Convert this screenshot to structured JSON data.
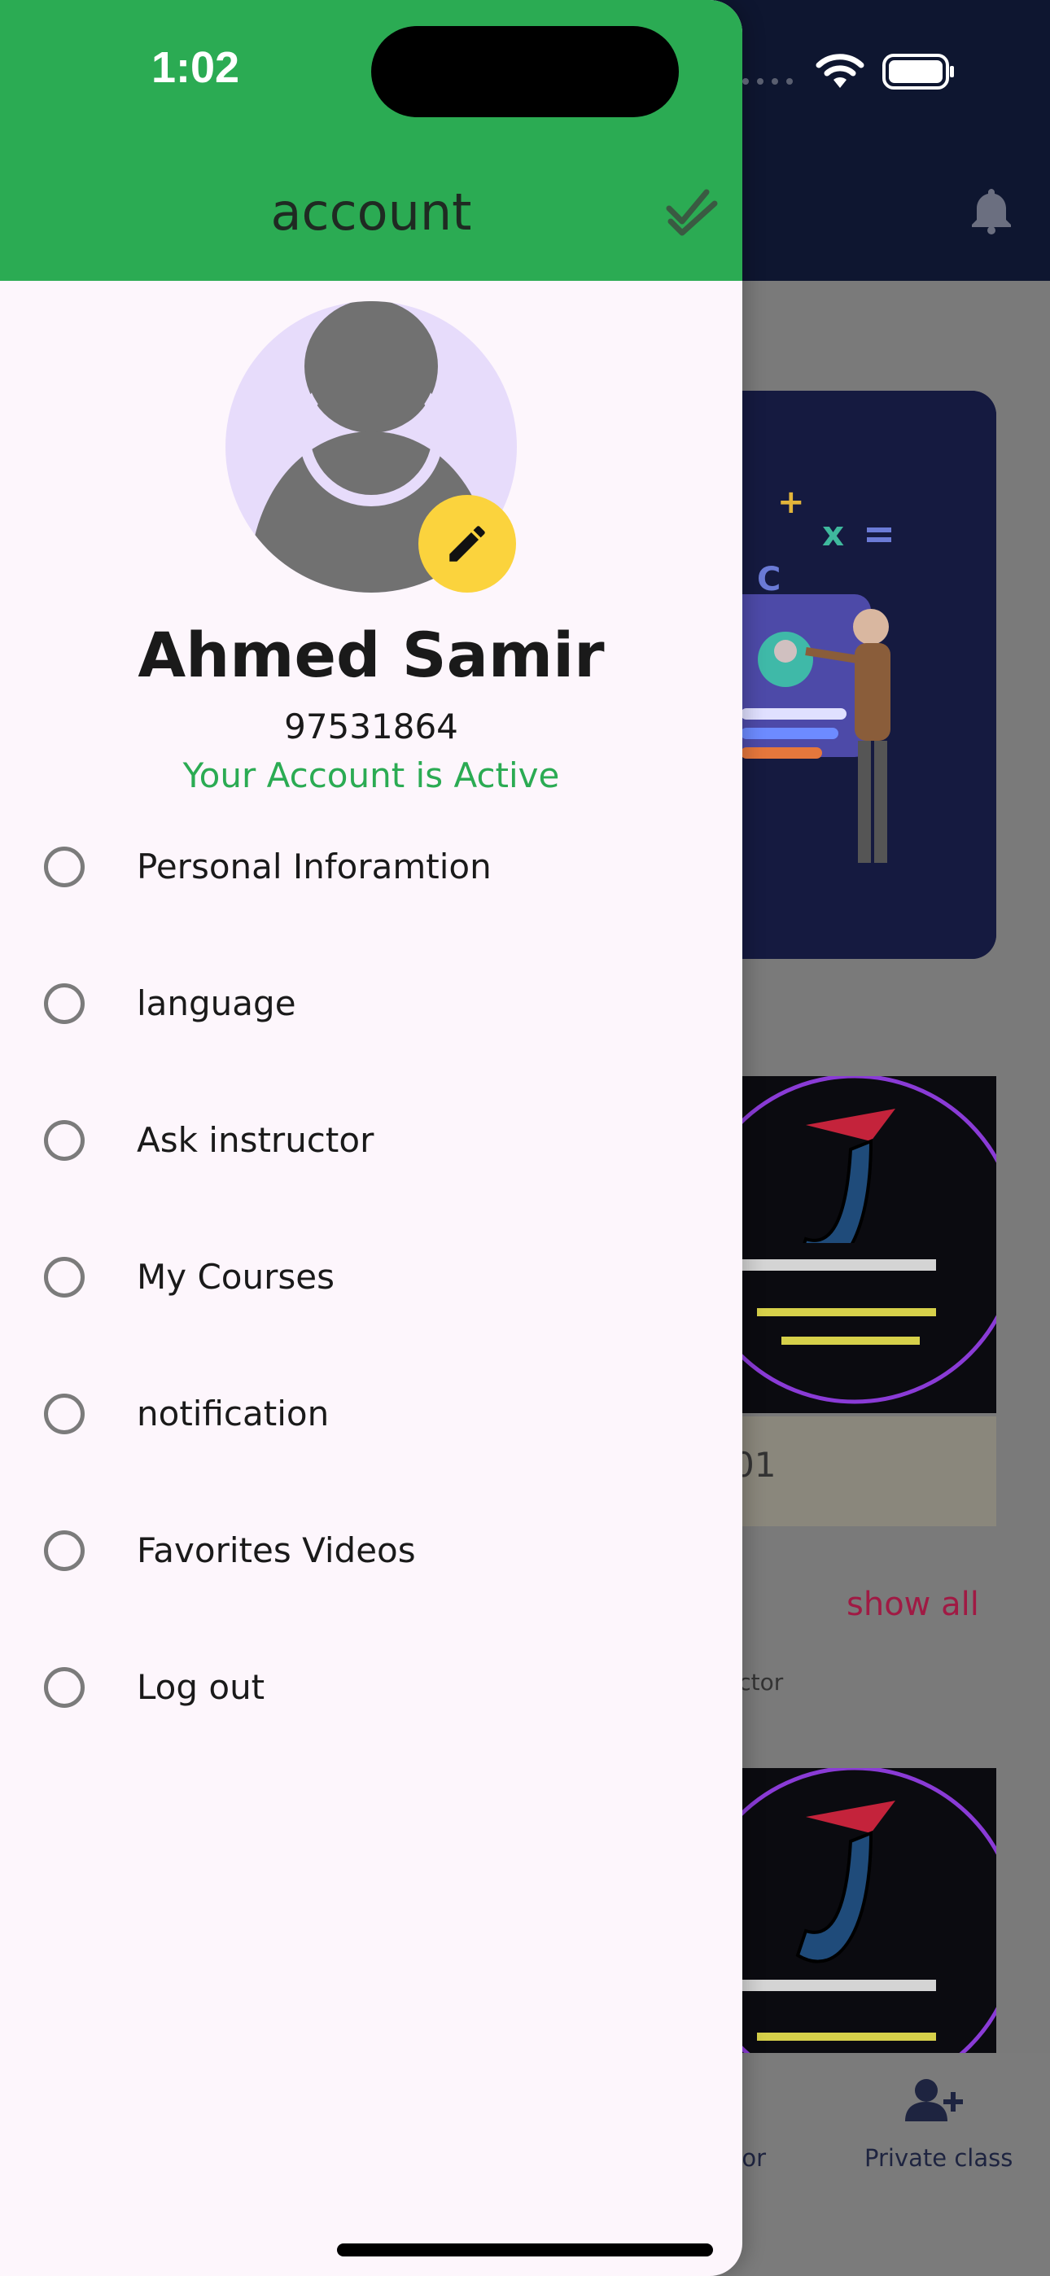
{
  "status_bar": {
    "time": "1:02"
  },
  "drawer": {
    "title": "account",
    "user_name": "Ahmed Samir",
    "phone": "97531864",
    "account_status": "Your Account is Active",
    "menu": [
      {
        "label": "Personal Inforamtion"
      },
      {
        "label": "language"
      },
      {
        "label": "Ask instructor"
      },
      {
        "label": "My Courses"
      },
      {
        "label": "notification"
      },
      {
        "label": "Favorites Videos"
      },
      {
        "label": "Log out"
      }
    ]
  },
  "background_app": {
    "card_title_fragment": "01",
    "show_all": "show all",
    "instructor_fragment": "ructor",
    "nav": {
      "partial_label": "tor",
      "private_class": "Private class"
    }
  },
  "colors": {
    "header_green": "#2bab53",
    "status_green": "#2bab53",
    "edit_yellow": "#fbd33d",
    "avatar_bg": "#e7dcfb",
    "dark_header": "#0e1630"
  },
  "icons": [
    "check-all-icon",
    "pencil-icon",
    "bell-icon",
    "wifi-icon",
    "battery-icon",
    "user-plus-icon"
  ]
}
